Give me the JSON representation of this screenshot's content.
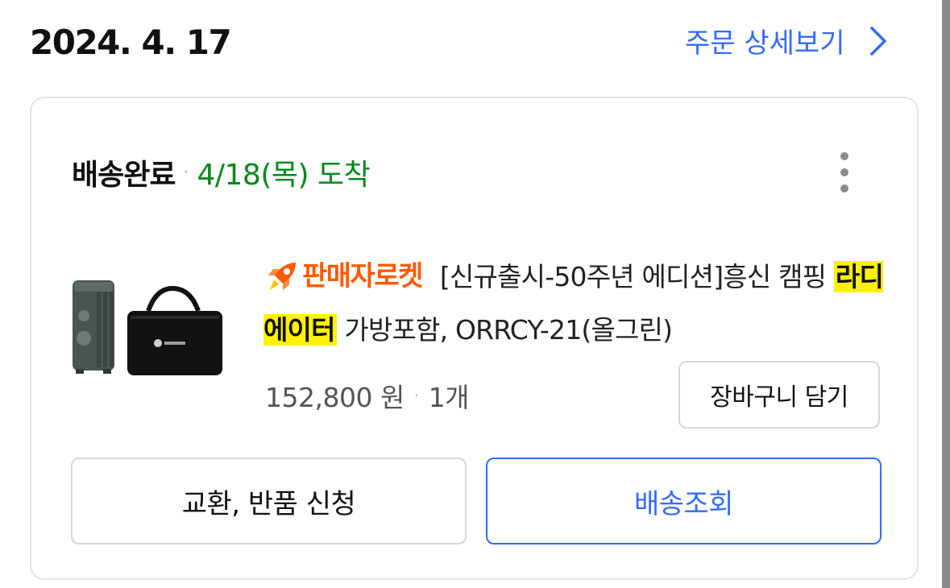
{
  "order": {
    "date": "2024. 4. 17",
    "detail_link_label": "주문 상세보기"
  },
  "delivery": {
    "status": "배송완료",
    "arrival": "4/18(목) 도착"
  },
  "product": {
    "badge_label": "판매자로켓",
    "title_part1": "[신규출시-50주년 에디션]흥신 캠핑 ",
    "title_highlight": "라디에이터",
    "title_part2": " 가방포함, ORRCY-21(올그린)",
    "price": "152,800 원",
    "quantity": "1개",
    "image_name": "radiator-with-bag"
  },
  "buttons": {
    "add_to_cart": "장바구니 담기",
    "return_request": "교환, 반품 신청",
    "track_delivery": "배송조회"
  },
  "colors": {
    "accent_blue": "#346aff",
    "arrival_green": "#00891a",
    "rocket_orange": "#ff5a00",
    "highlight_yellow": "#fff200"
  },
  "icons": {
    "detail_chevron": "chevron-right-icon",
    "more_menu": "more-vertical-icon",
    "rocket": "rocket-icon"
  }
}
